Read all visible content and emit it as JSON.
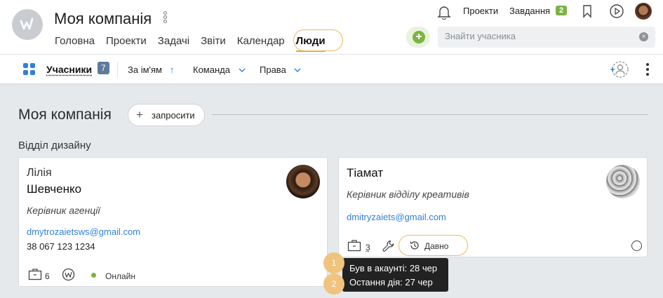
{
  "header": {
    "company_title": "Моя компанія",
    "nav": [
      "Головна",
      "Проекти",
      "Задачі",
      "Звіти",
      "Календар",
      "Люди"
    ],
    "active_nav": "Люди",
    "links": {
      "projects": "Проекти",
      "tasks": "Завдання",
      "tasks_count": "2"
    },
    "search_placeholder": "Знайти учасника",
    "accent_color": "#7cb342",
    "highlight_color": "#efb860"
  },
  "toolbar": {
    "members_label": "Учасники",
    "members_count": "7",
    "sort_by": "За ім'ям",
    "team_filter": "Команда",
    "rights_filter": "Права"
  },
  "content": {
    "section_title": "Моя компанія",
    "invite_label": "запросити",
    "department": "Відділ дизайну",
    "members": [
      {
        "first_name": "Лілія",
        "last_name": "Шевченко",
        "role": "Керівник агенції",
        "email": "dmytrozaietsws@gmail.com",
        "phone": "38 067 123 1234",
        "projects_count": "6",
        "status": "Онлайн"
      },
      {
        "name": "Тіамат",
        "role": "Керівник відділу креативів",
        "email": "dmitryzaiets@gmail.com",
        "projects_count": "3",
        "status": "Давно"
      }
    ]
  },
  "tooltip": {
    "steps": [
      "1",
      "2"
    ],
    "line1": "Був в акаунті: 28 чер",
    "line2": "Остання дія: 27 чер"
  }
}
